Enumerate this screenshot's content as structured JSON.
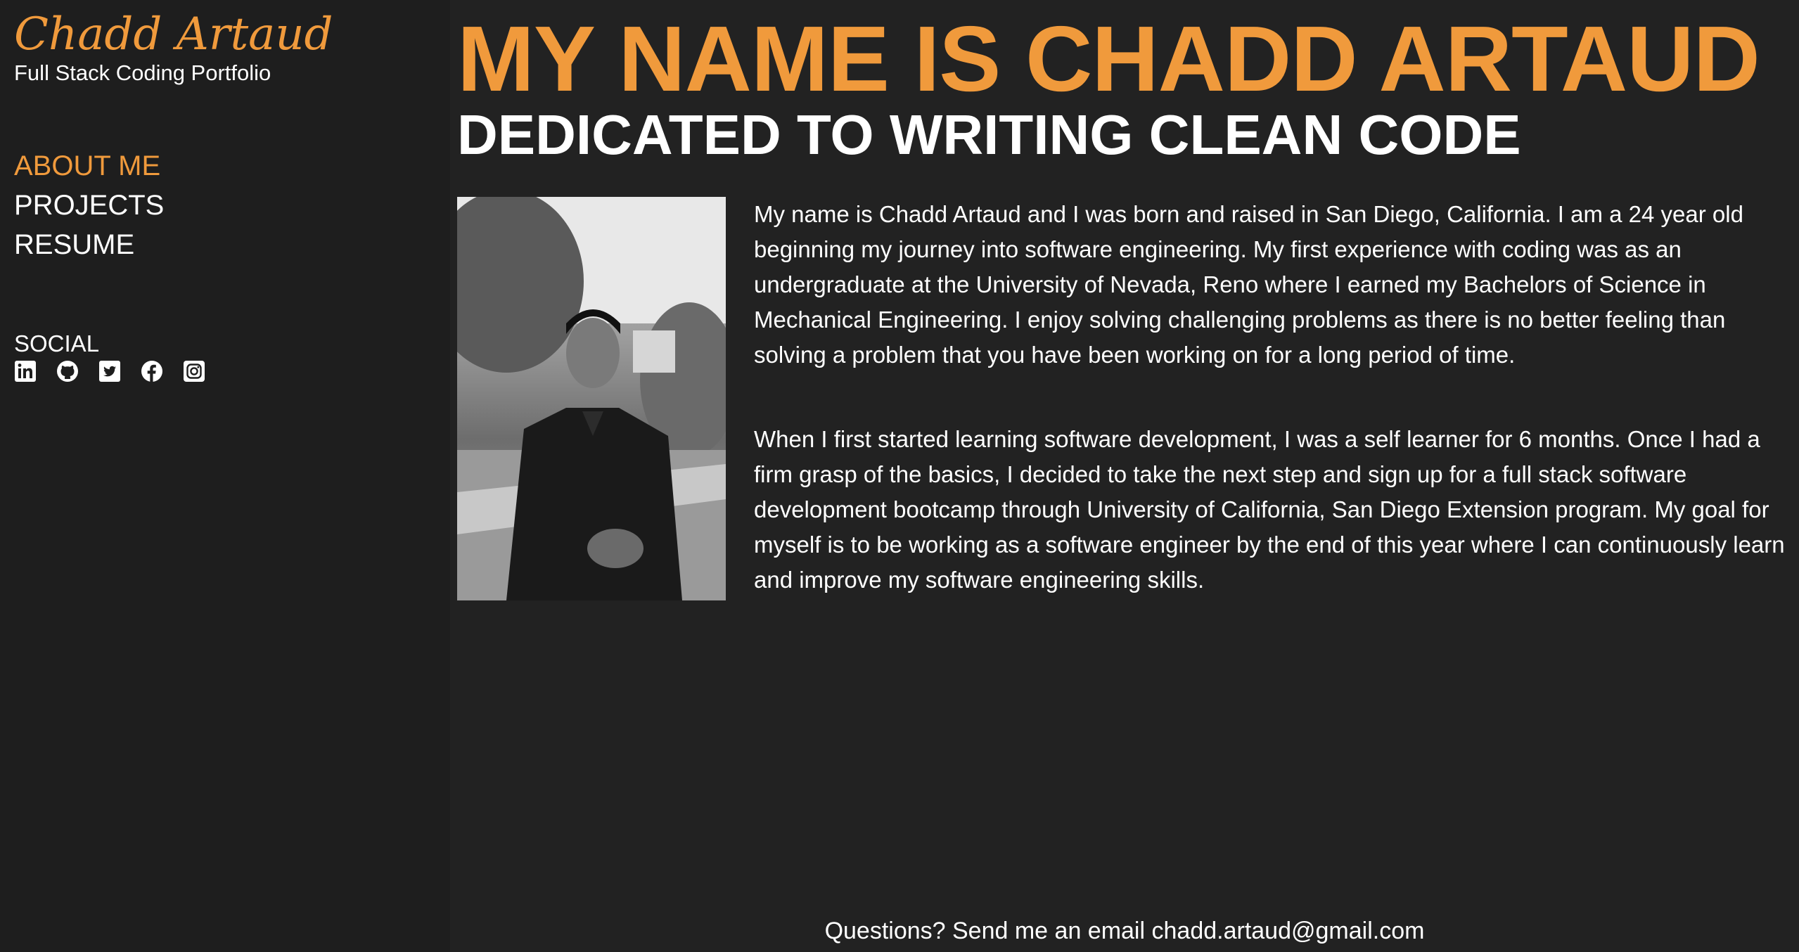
{
  "sidebar": {
    "brand_name": "Chadd Artaud",
    "brand_subtitle": "Full Stack Coding Portfolio",
    "nav": [
      {
        "label": "ABOUT ME",
        "active": true
      },
      {
        "label": "PROJECTS",
        "active": false
      },
      {
        "label": "RESUME",
        "active": false
      }
    ],
    "social_title": "SOCIAL",
    "social_icons": [
      "linkedin-icon",
      "github-icon",
      "twitter-icon",
      "facebook-icon",
      "instagram-icon"
    ]
  },
  "main": {
    "title": "MY NAME IS CHADD ARTAUD",
    "subtitle": "DEDICATED TO WRITING CLEAN CODE",
    "bio": [
      "My name is Chadd Artaud and I was born and raised in San Diego, California. I am a 24 year old beginning my journey into software engineering. My first experience with coding was as an undergraduate at the University of Nevada, Reno where I earned my Bachelors of Science in Mechanical Engineering. I enjoy solving challenging problems as there is no better feeling than solving a problem that you have been working on for a long period of time.",
      "When I first started learning software development, I was a self learner for 6 months. Once I had a firm grasp of the basics, I decided to take the next step and sign up for a full stack software development bootcamp through University of California, San Diego Extension program. My goal for myself is to be working as a software engineer by the end of this year where I can continuously learn and improve my software engineering skills."
    ]
  },
  "footer": {
    "prefix": "Questions? Send me an email",
    "email": "chadd.artaud@gmail.com"
  },
  "colors": {
    "accent": "#f09a3c",
    "sidebar_bg": "#1e1e1e",
    "main_bg": "#222222",
    "text": "#ffffff"
  }
}
